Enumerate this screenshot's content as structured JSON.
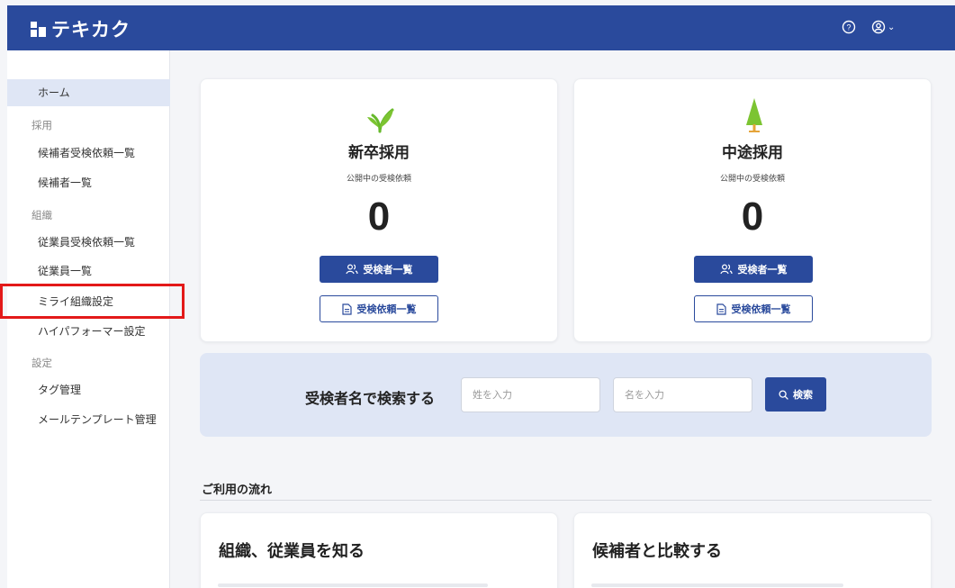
{
  "header": {
    "app_name": "テキカク",
    "help_icon": "help-circle-icon",
    "account_icon": "user-circle-icon",
    "account_chevron": "⌄"
  },
  "sidebar": {
    "home": "ホーム",
    "sections": [
      {
        "label": "採用",
        "items": [
          "候補者受検依頼一覧",
          "候補者一覧"
        ]
      },
      {
        "label": "組織",
        "items": [
          "従業員受検依頼一覧",
          "従業員一覧",
          "ミライ組織設定",
          "ハイパフォーマー設定"
        ]
      },
      {
        "label": "設定",
        "items": [
          "タグ管理",
          "メールテンプレート管理"
        ]
      }
    ]
  },
  "cards": [
    {
      "title": "新卒採用",
      "subtitle": "公開中の受検依頼",
      "count": "0",
      "primary_label": "受検者一覧",
      "secondary_label": "受検依頼一覧",
      "icon": "sprout-icon"
    },
    {
      "title": "中途採用",
      "subtitle": "公開中の受検依頼",
      "count": "0",
      "primary_label": "受検者一覧",
      "secondary_label": "受検依頼一覧",
      "icon": "tree-icon"
    }
  ],
  "search": {
    "title": "受検者名で検索する",
    "last_name_placeholder": "姓を入力",
    "first_name_placeholder": "名を入力",
    "button_label": "検索"
  },
  "flow": {
    "title": "ご利用の流れ",
    "cards": [
      "組織、従業員を知る",
      "候補者と比較する"
    ]
  },
  "colors": {
    "brand": "#2a4a9c",
    "highlight": "#e31919",
    "active_nav": "#dfe6f5"
  }
}
